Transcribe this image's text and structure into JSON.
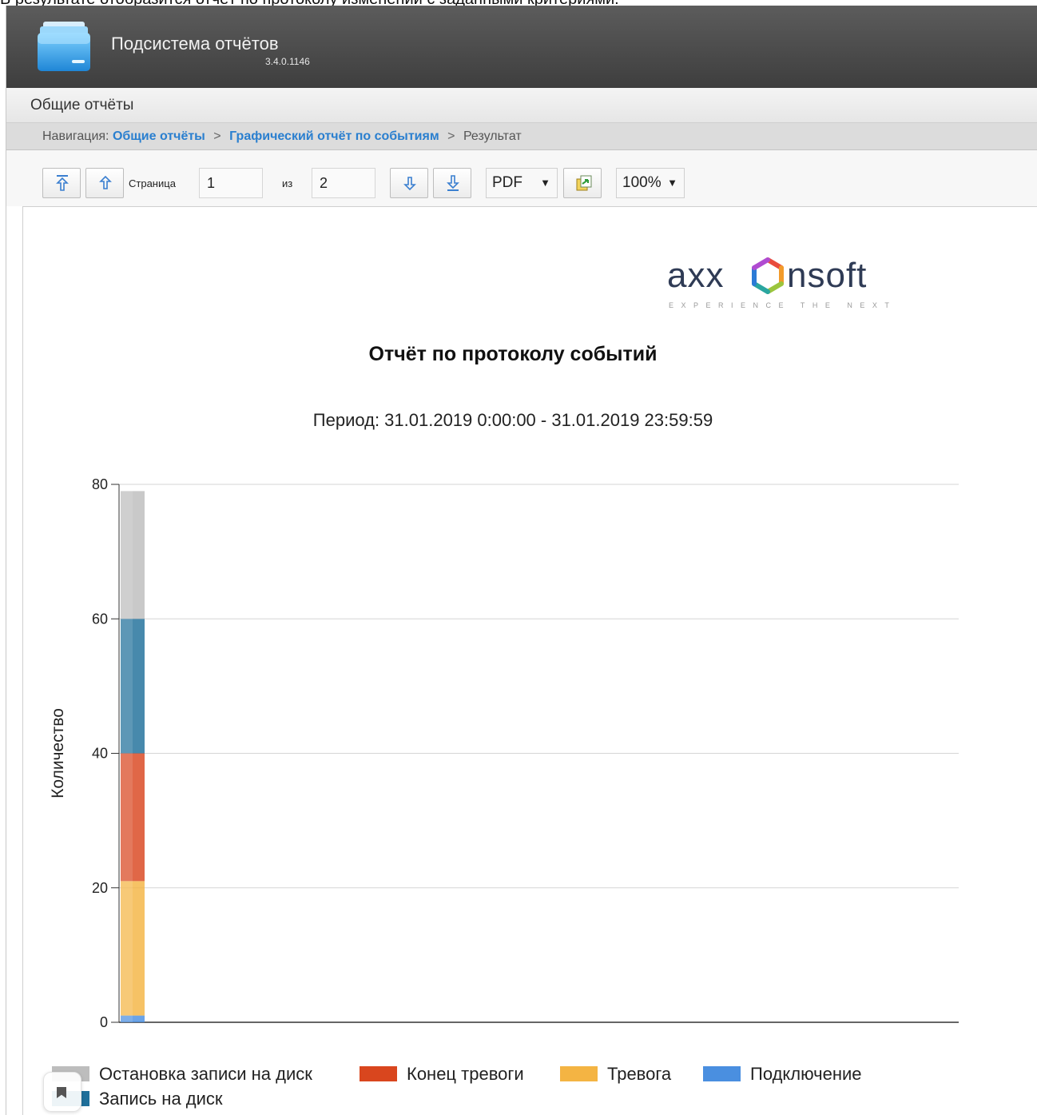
{
  "caption": "В результате отобразится отчёт по протоколу изменений с заданными критериями.",
  "header": {
    "title": "Подсистема отчётов",
    "version": "3.4.0.1146",
    "logo_icon": "folder-icon"
  },
  "menu": {
    "items": [
      {
        "label": "Общие отчёты"
      }
    ]
  },
  "breadcrumb": {
    "prefix": "Навигация:",
    "items": [
      {
        "label": "Общие отчёты",
        "link": true
      },
      {
        "label": "Графический отчёт по событиям",
        "link": true
      },
      {
        "label": "Результат",
        "link": false
      }
    ],
    "separator": ">"
  },
  "toolbar": {
    "page_label": "Страница",
    "page_value": "1",
    "of_label": "из",
    "total_pages": "2",
    "export_format": "PDF",
    "zoom": "100%",
    "icons": [
      "first-page-icon",
      "prev-page-icon",
      "next-page-icon",
      "last-page-icon",
      "export-icon"
    ]
  },
  "report": {
    "brand_text": "axxonsoft",
    "brand_tagline": "EXPERIENCE THE NEXT",
    "title": "Отчёт по протоколу событий",
    "period": "Период: 31.01.2019 0:00:00 - 31.01.2019 23:59:59"
  },
  "chart_data": {
    "type": "bar",
    "stacked": true,
    "title": "",
    "xlabel": "",
    "ylabel": "Количество",
    "ylim": [
      0,
      80
    ],
    "yticks": [
      0,
      20,
      40,
      60,
      80
    ],
    "grid": true,
    "categories": [
      ""
    ],
    "series": [
      {
        "name": "Подключение",
        "color": "#4a8fe0",
        "values": [
          1
        ]
      },
      {
        "name": "Тревога",
        "color": "#f4b443",
        "values": [
          20
        ]
      },
      {
        "name": "Конец тревоги",
        "color": "#d9461e",
        "values": [
          19
        ]
      },
      {
        "name": "Запись на диск",
        "color": "#1f6f9a",
        "values": [
          20
        ]
      },
      {
        "name": "Остановка записи на диск",
        "color": "#bdbdbd",
        "values": [
          19
        ]
      }
    ],
    "legend_order": [
      "Остановка записи на диск",
      "Конец тревоги",
      "Тревога",
      "Подключение",
      "Запись на диск"
    ],
    "legend_position": "bottom"
  }
}
